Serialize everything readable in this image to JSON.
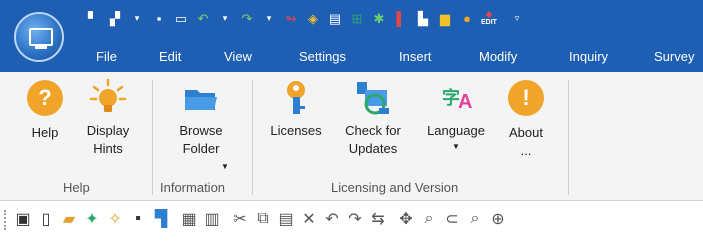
{
  "menu": [
    "File",
    "Edit",
    "View",
    "Settings",
    "Insert",
    "Modify",
    "Inquiry",
    "Survey"
  ],
  "qat_edit_label": "EDIT",
  "groups": {
    "help": {
      "label": "Help",
      "buttons": [
        "Help",
        "Display Hints"
      ]
    },
    "information": {
      "label": "Information",
      "buttons": [
        "Browse Folder"
      ]
    },
    "licensing": {
      "label": "Licensing and Version",
      "buttons": [
        "Licenses",
        "Check for Updates",
        "Language",
        "About ..."
      ]
    }
  },
  "colors": {
    "topbar": "#1e5fb3",
    "ribbon_bg": "#f4f4f4",
    "accent_orange": "#f0a52a"
  }
}
